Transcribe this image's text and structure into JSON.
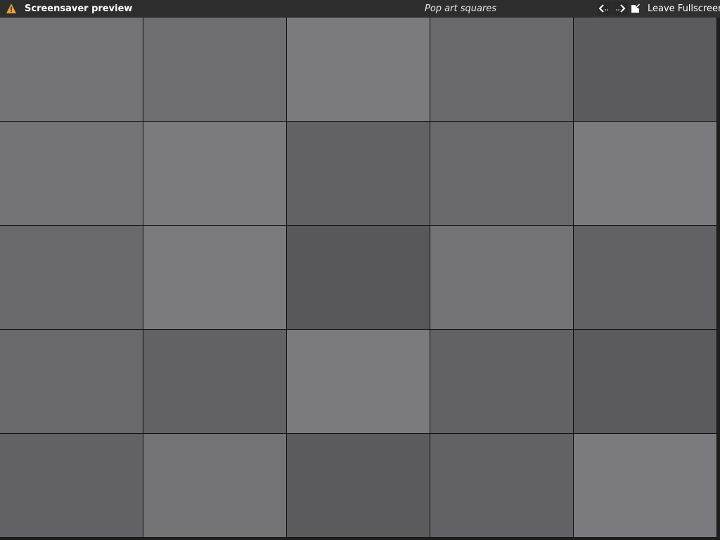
{
  "titlebar": {
    "title": "Screensaver preview",
    "screensaver_name": "Pop art squares",
    "warning_icon": "warning-icon",
    "prev_icon": "arrow-left-icon",
    "next_icon": "arrow-right-icon",
    "leave_fullscreen_icon": "leave-fullscreen-icon",
    "leave_fullscreen_label": "Leave Fullscreen"
  },
  "colors": {
    "titlebar_bg": "#2d2d2d",
    "warning": "#e8a235",
    "grid_line": "#111111"
  },
  "tiles": [
    [
      "#737275",
      "#6e6d70",
      "#7b7a7e",
      "#69686c",
      "#5b5b5e"
    ],
    [
      "#737275",
      "#7b7a7e",
      "#626165",
      "#69686c",
      "#7b7a7e"
    ],
    [
      "#69686c",
      "#7b7a7e",
      "#58575b",
      "#737275",
      "#626165"
    ],
    [
      "#69686c",
      "#626165",
      "#7b7a7e",
      "#626165",
      "#5b5b5e"
    ],
    [
      "#626165",
      "#737275",
      "#5b5b5e",
      "#626165",
      "#7b7a7e"
    ]
  ]
}
